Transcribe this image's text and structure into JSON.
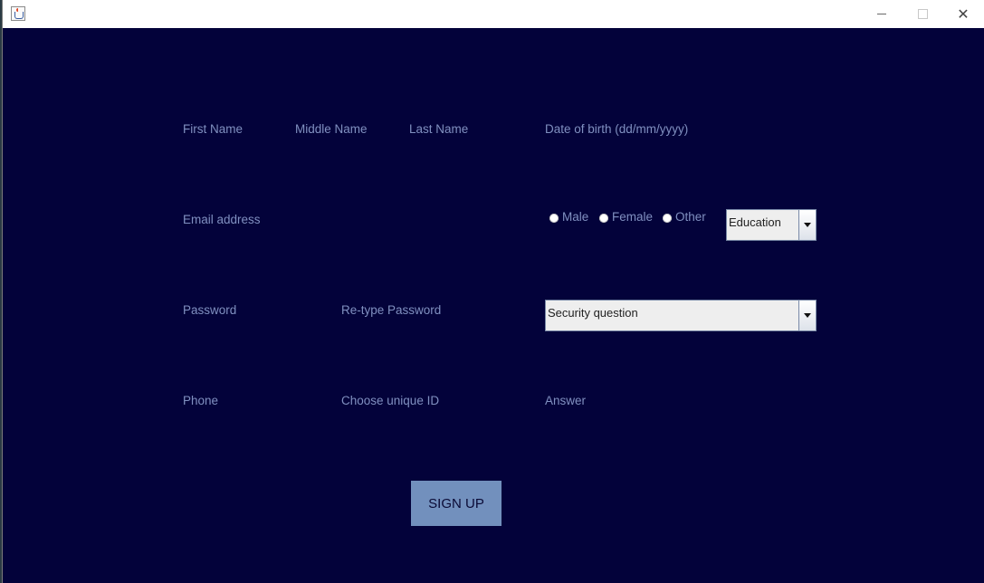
{
  "window": {
    "controls": {
      "minimize_icon": "minimize-icon",
      "maximize_icon": "maximize-icon",
      "close_glyph": "✕"
    }
  },
  "form": {
    "labels": {
      "first_name": "First Name",
      "middle_name": "Middle Name",
      "last_name": "Last Name",
      "dob": "Date of birth (dd/mm/yyyy)",
      "email": "Email address",
      "password": "Password",
      "retype_password": "Re-type Password",
      "phone": "Phone",
      "unique_id": "Choose unique ID",
      "answer": "Answer"
    },
    "gender": {
      "options": [
        "Male",
        "Female",
        "Other"
      ]
    },
    "education_select": {
      "selected": "Education"
    },
    "security_select": {
      "selected": "Security question"
    },
    "signup_label": "SIGN UP"
  },
  "colors": {
    "background": "#03023a",
    "label": "#8090c0",
    "button": "#7290bd"
  }
}
